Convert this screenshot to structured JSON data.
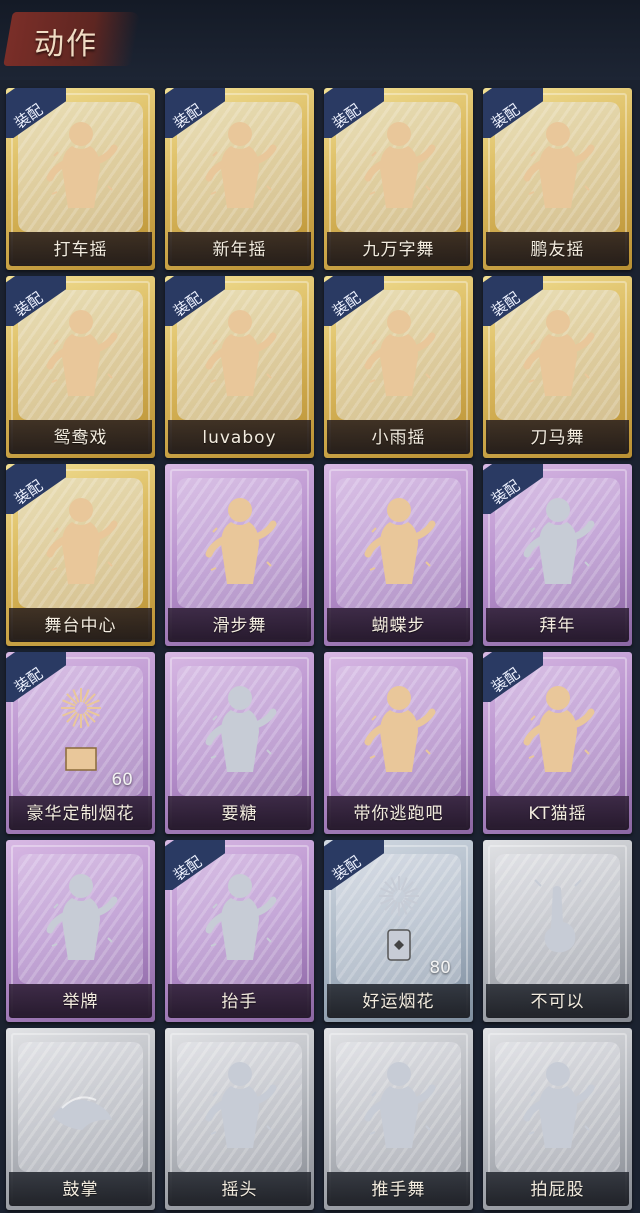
{
  "header": {
    "title": "动作"
  },
  "badge_label": "装配",
  "colors": {
    "gold": "#d9b75b",
    "purple": "#b58ecb",
    "blue": "#a9b6c4",
    "silver": "#b3b6bc",
    "badge": "#2a3a63",
    "figure_gold": "#e9c79a",
    "figure_grey": "#c7ccd6"
  },
  "actions": [
    {
      "label": "打车摇",
      "tier": "gold",
      "equipped": true,
      "icon": "figure-shrug-icon"
    },
    {
      "label": "新年摇",
      "tier": "gold",
      "equipped": true,
      "icon": "figure-clap-icon"
    },
    {
      "label": "九万字舞",
      "tier": "gold",
      "equipped": true,
      "icon": "figure-hug-icon"
    },
    {
      "label": "鹏友摇",
      "tier": "gold",
      "equipped": true,
      "icon": "figure-point-icon"
    },
    {
      "label": "鸳鸯戏",
      "tier": "gold",
      "equipped": true,
      "icon": "figure-dance-icon"
    },
    {
      "label": "luvaboy",
      "tier": "gold",
      "equipped": true,
      "icon": "figure-cross-arms-icon"
    },
    {
      "label": "小雨摇",
      "tier": "gold",
      "equipped": true,
      "icon": "figure-wave-icon"
    },
    {
      "label": "刀马舞",
      "tier": "gold",
      "equipped": true,
      "icon": "figure-sway-icon"
    },
    {
      "label": "舞台中心",
      "tier": "gold",
      "equipped": true,
      "icon": "figure-sparkle-icon"
    },
    {
      "label": "滑步舞",
      "tier": "purple",
      "equipped": false,
      "icon": "figure-slide-icon"
    },
    {
      "label": "蝴蝶步",
      "tier": "purple",
      "equipped": false,
      "icon": "figure-butterfly-icon"
    },
    {
      "label": "拜年",
      "tier": "purple",
      "equipped": true,
      "icon": "figure-greet-icon"
    },
    {
      "label": "豪华定制烟花",
      "tier": "purple",
      "equipped": true,
      "icon": "fireworks-box-icon",
      "count": "60"
    },
    {
      "label": "要糖",
      "tier": "purple",
      "equipped": false,
      "icon": "figure-beg-icon"
    },
    {
      "label": "带你逃跑吧",
      "tier": "purple",
      "equipped": false,
      "icon": "figure-run-icon"
    },
    {
      "label": "KT猫摇",
      "tier": "purple",
      "equipped": true,
      "icon": "figure-cat-dance-icon"
    },
    {
      "label": "举牌",
      "tier": "purple",
      "equipped": false,
      "icon": "figure-sign-icon"
    },
    {
      "label": "抬手",
      "tier": "purple",
      "equipped": true,
      "icon": "figure-raise-hand-icon"
    },
    {
      "label": "好运烟花",
      "tier": "blue",
      "equipped": true,
      "icon": "fireworks-can-icon",
      "count": "80"
    },
    {
      "label": "不可以",
      "tier": "silver",
      "equipped": false,
      "icon": "finger-wag-icon"
    },
    {
      "label": "鼓掌",
      "tier": "silver",
      "equipped": false,
      "icon": "hands-clap-icon"
    },
    {
      "label": "摇头",
      "tier": "silver",
      "equipped": false,
      "icon": "figure-shake-head-icon"
    },
    {
      "label": "推手舞",
      "tier": "silver",
      "equipped": false,
      "icon": "figure-push-icon"
    },
    {
      "label": "拍屁股",
      "tier": "silver",
      "equipped": false,
      "icon": "figure-pat-icon"
    }
  ]
}
